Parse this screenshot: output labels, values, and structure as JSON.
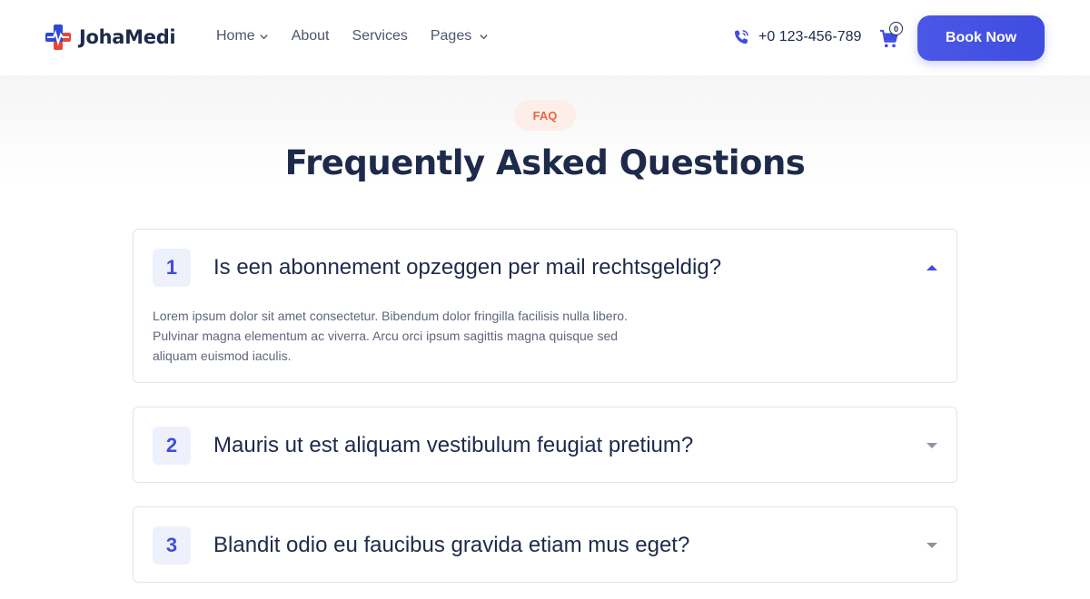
{
  "header": {
    "brand": "JohaMedi",
    "nav": [
      {
        "label": "Home",
        "has_dropdown": true
      },
      {
        "label": "About",
        "has_dropdown": false
      },
      {
        "label": "Services",
        "has_dropdown": false
      },
      {
        "label": "Pages",
        "has_dropdown": true
      }
    ],
    "phone": "+0 123-456-789",
    "cart_count": "0",
    "book_label": "Book Now"
  },
  "faq": {
    "badge": "FAQ",
    "title": "Frequently Asked Questions",
    "items": [
      {
        "number": "1",
        "question": "Is een abonnement opzeggen per mail rechtsgeldig?",
        "expanded": true,
        "answer_lines": [
          "Lorem ipsum dolor sit amet consectetur. Bibendum dolor fringilla facilisis nulla libero.",
          "Pulvinar magna elementum ac viverra. Arcu orci ipsum sagittis magna quisque sed",
          "aliquam euismod iaculis."
        ]
      },
      {
        "number": "2",
        "question": "Mauris ut est aliquam vestibulum feugiat pretium?",
        "expanded": false
      },
      {
        "number": "3",
        "question": "Blandit odio eu faucibus gravida etiam mus eget?",
        "expanded": false
      }
    ]
  },
  "colors": {
    "primary": "#3f4de0",
    "accent": "#e8663f",
    "text": "#1e2a4a",
    "muted": "#5f667d",
    "logo_blue": "#2e49d6",
    "logo_red": "#e5473a"
  },
  "icons": {
    "logo": "medical-cross-logo-icon",
    "phone": "phone-icon",
    "cart": "cart-icon",
    "expanded": "caret-up-icon",
    "collapsed": "caret-down-icon"
  }
}
